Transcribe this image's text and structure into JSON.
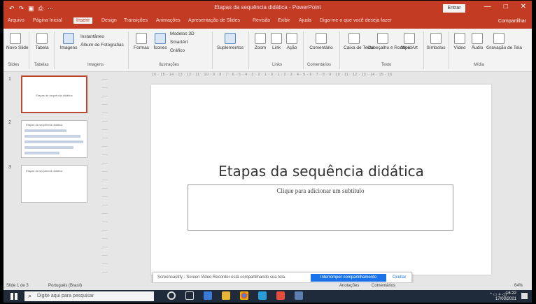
{
  "window": {
    "title": "Etapas da sequência didática - PowerPoint",
    "login_label": "Entrar",
    "min_glyph": "—",
    "restore_glyph": "□",
    "close_glyph": "✕"
  },
  "qat": [
    "↶",
    "↷",
    "▣",
    "⎙",
    "⋯"
  ],
  "tabs": [
    "Arquivo",
    "Página Inicial",
    "Inserir",
    "Design",
    "Transições",
    "Animações",
    "Apresentação de Slides",
    "Revisão",
    "Exibir",
    "Ajuda",
    "Diga-me o que você deseja fazer"
  ],
  "active_tab_index": 2,
  "share_label": "Compartilhar",
  "ribbon": {
    "new_slide": "Novo Slide",
    "table": "Tabela",
    "images": "Imagens",
    "screenshot": "Instantâneo",
    "photo_album": "Álbum de Fotografias",
    "shapes": "Formas",
    "icons": "Ícones",
    "models_3d": "Modelos 3D",
    "smartart": "SmartArt",
    "chart": "Gráfico",
    "addins": "Suplementos",
    "zoom": "Zoom",
    "link": "Link",
    "action": "Ação",
    "comment": "Comentário",
    "textbox": "Caixa de Texto",
    "header_footer": "Cabeçalho e Rodapé",
    "wordart": "WordArt",
    "symbols": "Símbolos",
    "video": "Vídeo",
    "audio": "Áudio",
    "screen_recording": "Gravação de Tela",
    "groups": {
      "slides": "Slides",
      "tables": "Tabelas",
      "images": "Imagens",
      "illustrations": "Ilustrações",
      "links": "Links",
      "comments": "Comentários",
      "text": "Texto",
      "media": "Mídia"
    }
  },
  "ruler_text": "16 · 15 · 14 · 13 · 12 · 11 · 10 · 9 · 8 · 7 · 6 · 5 · 4 · 3 · 2 · 1 · 0 · 1 · 2 · 3 · 4 · 5 · 6 · 7 · 8 · 9 · 10 · 11 · 12 · 13 · 14 · 15 · 16",
  "thumbnails": [
    {
      "num": "1",
      "text": "Etapas da sequência didática"
    },
    {
      "num": "2",
      "text": "Etapas da sequência didática"
    },
    {
      "num": "3",
      "text": "Etapas da sequência didática"
    }
  ],
  "slide": {
    "title": "Etapas da sequência didática",
    "subtitle_placeholder": "Clique para adicionar um subtítulo"
  },
  "banner": {
    "text": "Screencastify - Screen Video Recorder está compartilhando sua tela.",
    "stop_label": "Interromper compartilhamento",
    "hide_label": "Ocultar"
  },
  "status": {
    "slide_count": "Slide 1 de 3",
    "language": "Português (Brasil)",
    "notes": "Anotações",
    "comments": "Comentários",
    "zoom": "64%"
  },
  "taskbar": {
    "search_placeholder": "Digite aqui para pesquisar",
    "tray_text": "^ ▭ ⋄ ◁)",
    "lang": "POR",
    "time": "16:22",
    "date": "17/03/2021"
  },
  "colors": {
    "accent": "#c23b22",
    "taskbar": "#1f2a3a",
    "banner_button": "#1a73e8"
  }
}
